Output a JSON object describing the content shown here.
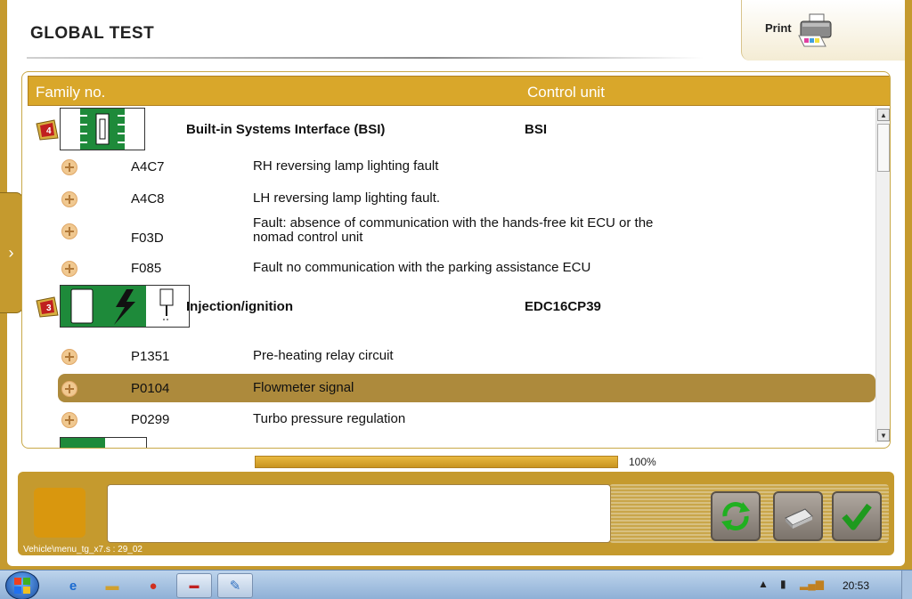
{
  "window": {
    "title": "GLOBAL TEST",
    "print_label": "Print"
  },
  "grid": {
    "headers": {
      "family": "Family no.",
      "unit": "Control unit"
    },
    "families": [
      {
        "flag": "4",
        "name": "Built-in Systems Interface (BSI)",
        "unit": "BSI",
        "faults": [
          {
            "code": "A4C7",
            "desc": "RH reversing lamp lighting fault"
          },
          {
            "code": "A4C8",
            "desc": "LH reversing lamp lighting fault."
          },
          {
            "code": "F03D",
            "desc": "Fault: absence of communication with the hands-free kit ECU or the nomad control unit"
          },
          {
            "code": "F085",
            "desc": "Fault no communication with the parking assistance ECU"
          }
        ]
      },
      {
        "flag": "3",
        "name": "Injection/ignition",
        "unit": "EDC16CP39",
        "faults": [
          {
            "code": "P1351",
            "desc": "Pre-heating relay circuit"
          },
          {
            "code": "P0104",
            "desc": "Flowmeter signal"
          },
          {
            "code": "P0299",
            "desc": "Turbo pressure regulation"
          }
        ]
      }
    ],
    "selected_fault": "P0104"
  },
  "progress": {
    "value": 1.0,
    "label": "100%"
  },
  "status_path": "Vehicle\\menu_tg_x7.s : 29_02",
  "taskbar": {
    "clock": "20:53"
  },
  "colors": {
    "gold": "#c59a2e",
    "header": "#d9a72a",
    "selected": "#ad8a3c"
  }
}
